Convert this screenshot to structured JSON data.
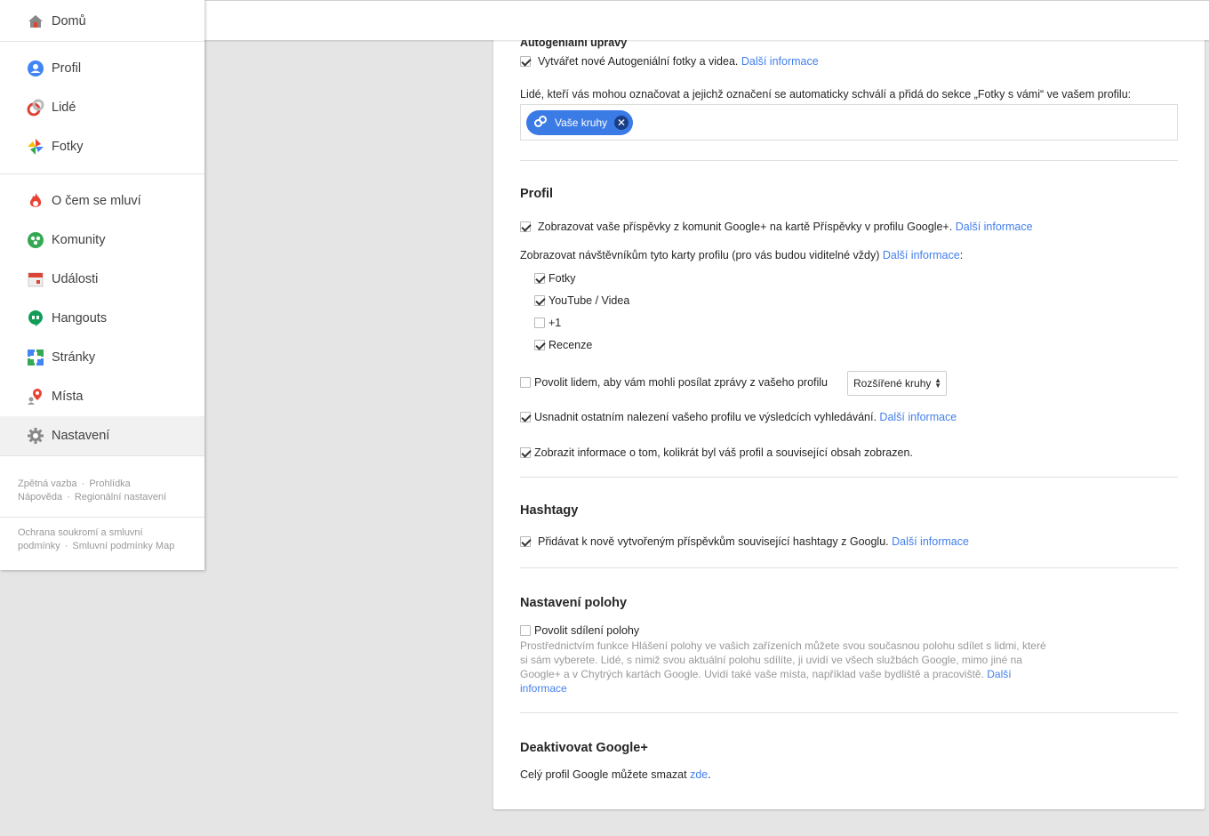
{
  "sidebar": {
    "items": [
      {
        "label": "Domů",
        "icon": "home-icon"
      },
      {
        "label": "Profil",
        "icon": "profile-icon"
      },
      {
        "label": "Lidé",
        "icon": "people-icon"
      },
      {
        "label": "Fotky",
        "icon": "photos-icon"
      },
      {
        "label": "O čem se mluví",
        "icon": "trending-icon"
      },
      {
        "label": "Komunity",
        "icon": "communities-icon"
      },
      {
        "label": "Události",
        "icon": "events-icon"
      },
      {
        "label": "Hangouts",
        "icon": "hangouts-icon"
      },
      {
        "label": "Stránky",
        "icon": "pages-icon"
      },
      {
        "label": "Místa",
        "icon": "places-icon"
      },
      {
        "label": "Nastavení",
        "icon": "settings-icon"
      }
    ],
    "footer": {
      "feedback": "Zpětná vazba",
      "tour": "Prohlídka",
      "help": "Nápověda",
      "regional": "Regionální nastavení",
      "privacy": "Ochrana soukromí a smluvní podmínky",
      "maps_terms": "Smluvní podmínky Map"
    }
  },
  "autoawesome": {
    "title": "Autogeniální úpravy",
    "create_label": "Vytvářet nové Autogeniální fotky a videa.",
    "create_checked": true,
    "more_info": "Další informace",
    "tagging_label": "Lidé, kteří vás mohou označovat a jejichž označení se automaticky schválí a přidá do sekce „Fotky s vámi“ ve vašem profilu:",
    "chip_label": "Vaše kruhy",
    "chip_remove": "✕"
  },
  "profile": {
    "title": "Profil",
    "communities_label": "Zobrazovat vaše příspěvky z komunit Google+ na kartě Příspěvky v profilu Google+.",
    "communities_checked": true,
    "more_info": "Další informace",
    "tabs_label": "Zobrazovat návštěvníkům tyto karty profilu (pro vás budou viditelné vždy)",
    "tabs_colon": ":",
    "tabs": [
      {
        "label": "Fotky",
        "checked": true
      },
      {
        "label": "YouTube / Videa",
        "checked": true
      },
      {
        "label": "+1",
        "checked": false
      },
      {
        "label": "Recenze",
        "checked": true
      }
    ],
    "messages_label": "Povolit lidem, aby vám mohli posílat zprávy z vašeho profilu",
    "messages_checked": false,
    "messages_select": "Rozšířené kruhy",
    "search_label": "Usnadnit ostatním nalezení vašeho profilu ve výsledcích vyhledávání.",
    "search_checked": true,
    "views_label": "Zobrazit informace o tom, kolikrát byl váš profil a související obsah zobrazen.",
    "views_checked": true
  },
  "hashtags": {
    "title": "Hashtagy",
    "label": "Přidávat k nově vytvořeným příspěvkům související hashtagy z Googlu.",
    "checked": true,
    "more_info": "Další informace"
  },
  "location": {
    "title": "Nastavení polohy",
    "label": "Povolit sdílení polohy",
    "checked": false,
    "description": "Prostřednictvím funkce Hlášení polohy ve vašich zařízeních můžete svou současnou polohu sdílet s lidmi, které si sám vyberete. Lidé, s nimiž svou aktuální polohu sdílíte, ji uvidí ve všech službách Google, mimo jiné na Google+ a v Chytrých kartách Google. Uvidí také vaše místa, například vaše bydliště a pracoviště.",
    "more_info": "Další informace"
  },
  "deactivate": {
    "title": "Deaktivovat Google+",
    "text": "Celý profil Google můžete smazat",
    "link": "zde",
    "period": "."
  }
}
